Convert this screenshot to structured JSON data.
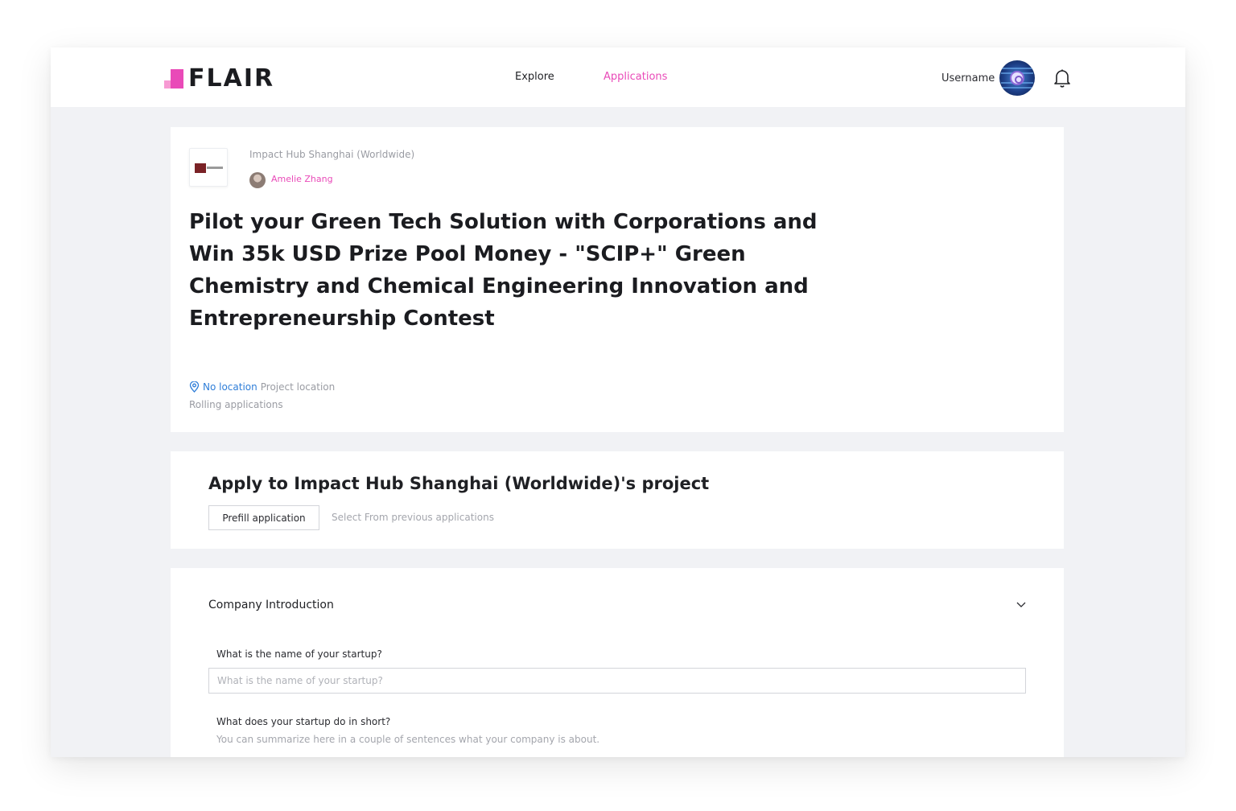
{
  "header": {
    "logo_text": "FLAIR",
    "nav": {
      "explore": "Explore",
      "applications": "Applications"
    },
    "username": "Username",
    "accent_color": "#e94ab8"
  },
  "project": {
    "org_name": "Impact Hub Shanghai (Worldwide)",
    "owner_name": "Amelie Zhang",
    "title": "Pilot your Green Tech Solution with Corporations and Win 35k USD Prize Pool Money - \"SCIP+\" Green Chemistry and Chemical Engineering Innovation and Entrepreneurship Contest",
    "location_value": "No location",
    "location_label": "Project location",
    "deadline": "Rolling applications"
  },
  "apply": {
    "title": "Apply to Impact Hub Shanghai (Worldwide)'s project",
    "prefill_label": "Prefill application",
    "select_previous": "Select From previous applications"
  },
  "form": {
    "section_title": "Company Introduction",
    "q1_label": "What is the name of your startup?",
    "q1_placeholder": "What is the name of your startup?",
    "q1_value": "",
    "q2_label": "What does your startup do in short?",
    "q2_help": "You can summarize here in a couple of sentences what your company is about."
  },
  "icons": {
    "logo": "flair-logo-icon",
    "avatar": "user-avatar-icon",
    "bell": "bell-icon",
    "pin": "location-pin-icon",
    "chevron": "chevron-down-icon"
  }
}
